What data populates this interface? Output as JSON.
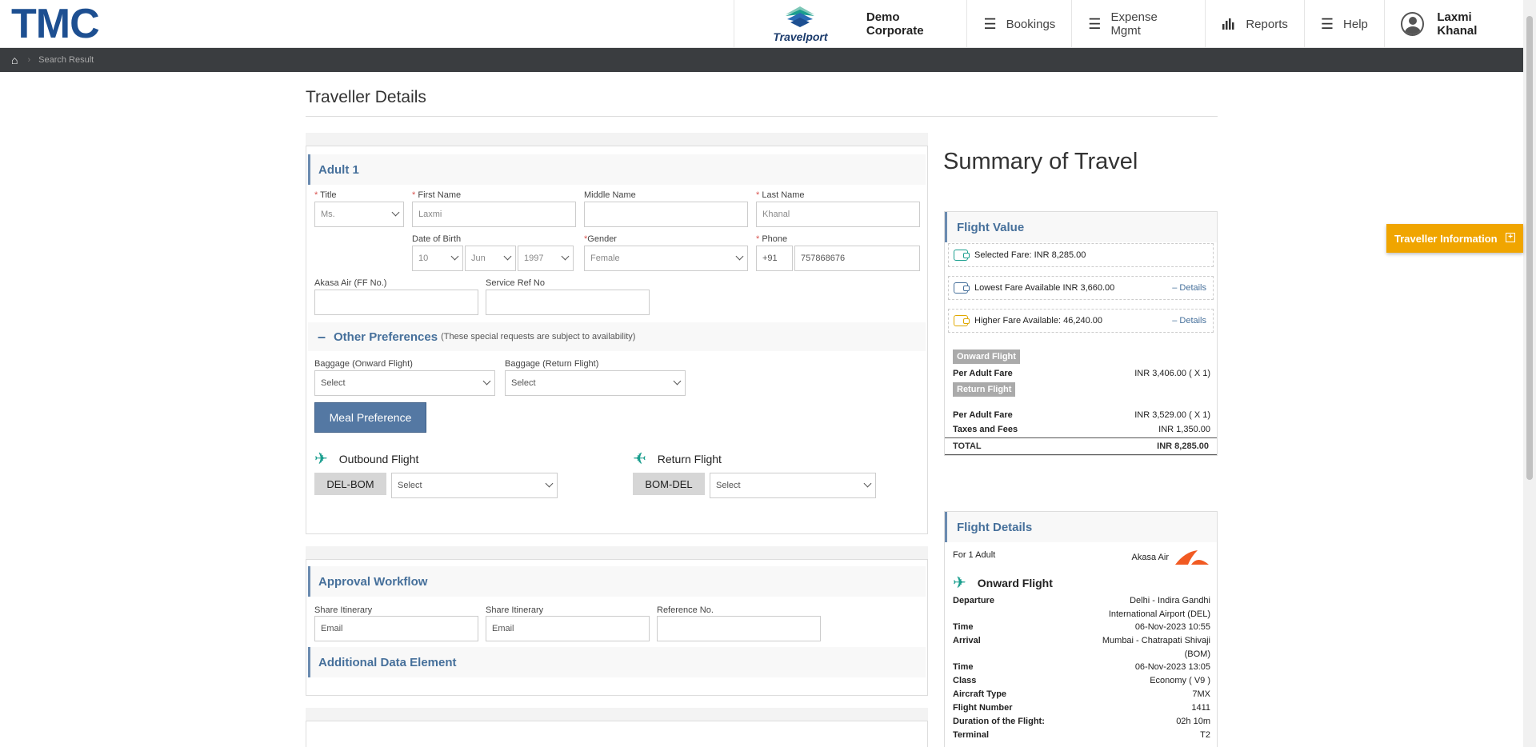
{
  "header": {
    "logo": "TMC",
    "partner": "Travelport",
    "corporate": "Demo Corporate",
    "nav": [
      {
        "label": "Bookings",
        "icon": "menu-icon"
      },
      {
        "label": "Expense Mgmt",
        "icon": "menu-icon"
      },
      {
        "label": "Reports",
        "icon": "bar-chart-icon"
      },
      {
        "label": "Help",
        "icon": "menu-icon"
      }
    ],
    "user": "Laxmi Khanal"
  },
  "breadcrumb": {
    "current": "Search Result"
  },
  "page": {
    "title": "Traveller Details"
  },
  "adult": {
    "heading": "Adult 1",
    "labels": {
      "title": "Title",
      "first_name": "First Name",
      "middle_name": "Middle Name",
      "last_name": "Last Name",
      "dob": "Date of Birth",
      "gender": "Gender",
      "phone": "Phone",
      "ff": "Akasa Air (FF No.)",
      "service_ref": "Service Ref No"
    },
    "required_mark": "*",
    "values": {
      "title": "Ms.",
      "first_name": "Laxmi",
      "middle_name": "",
      "last_name": "Khanal",
      "dob_day": "10",
      "dob_month": "Jun",
      "dob_year": "1997",
      "gender": "Female",
      "phone_code": "+91",
      "phone": "757868676",
      "ff": "",
      "service_ref": ""
    }
  },
  "preferences": {
    "heading": "Other Preferences",
    "note": "(These special requests are subject to availability)",
    "baggage_onward_label": "Baggage (Onward Flight)",
    "baggage_return_label": "Baggage (Return Flight)",
    "baggage_onward": "Select",
    "baggage_return": "Select",
    "meal_button": "Meal Preference",
    "outbound_label": "Outbound Flight",
    "return_label": "Return Flight",
    "outbound_route": "DEL-BOM",
    "return_route": "BOM-DEL",
    "outbound_meal": "Select",
    "return_meal": "Select"
  },
  "approval": {
    "heading": "Approval Workflow",
    "share1_label": "Share Itinerary",
    "share2_label": "Share Itinerary",
    "ref_label": "Reference No.",
    "email_placeholder": "Email",
    "additional_heading": "Additional Data Element"
  },
  "summary": {
    "title": "Summary of Travel",
    "flight_value": "Flight Value",
    "selected_fare": "Selected Fare: INR 8,285.00",
    "lowest_fare": "Lowest Fare Available INR 3,660.00",
    "higher_fare": "Higher Fare Available: 46,240.00",
    "details_link": "– Details",
    "onward_pill": "Onward Flight",
    "return_pill": "Return Flight",
    "per_adult_label": "Per Adult Fare",
    "onward_fare": "INR 3,406.00 ( X 1)",
    "return_fare": "INR 3,529.00 ( X 1)",
    "taxes_label": "Taxes and Fees",
    "taxes": "INR 1,350.00",
    "total_label": "TOTAL",
    "total": "INR 8,285.00",
    "colors": {
      "selected": "#1a9e8e",
      "lowest": "#46709b",
      "higher": "#e0a800"
    }
  },
  "flight_details": {
    "heading": "Flight Details",
    "for": "For 1 Adult",
    "airline": "Akasa Air",
    "onward_label": "Onward Flight",
    "rows": [
      {
        "k": "Departure",
        "v": "Delhi - Indira Gandhi International Airport (DEL)"
      },
      {
        "k": "Time",
        "v": "06-Nov-2023 10:55"
      },
      {
        "k": "Arrival",
        "v": "Mumbai - Chatrapati Shivaji (BOM)"
      },
      {
        "k": "Time",
        "v": "06-Nov-2023 13:05"
      },
      {
        "k": "Class",
        "v": "Economy ( V9 )"
      },
      {
        "k": "Aircraft Type",
        "v": "7MX"
      },
      {
        "k": "Flight Number",
        "v": "1411"
      },
      {
        "k": "Duration of the Flight:",
        "v": "02h 10m"
      },
      {
        "k": "Terminal",
        "v": "T2"
      }
    ]
  },
  "traveller_info_button": "Traveller Information"
}
